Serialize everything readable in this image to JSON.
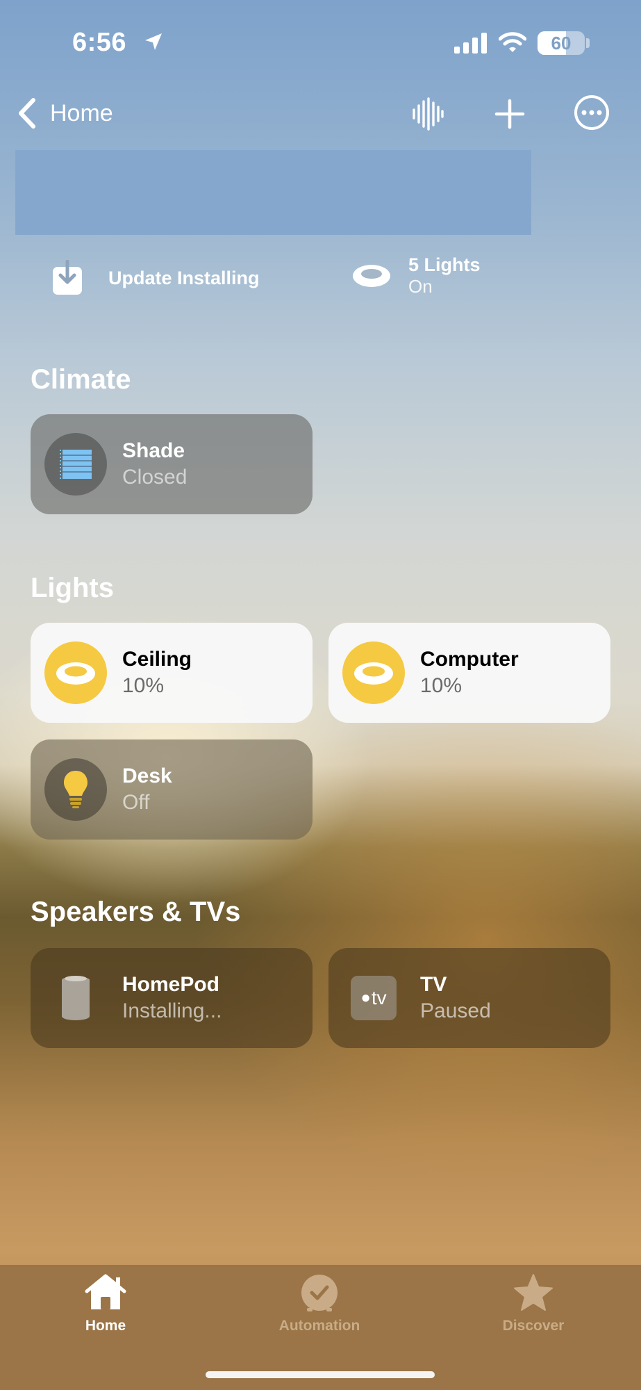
{
  "status_bar": {
    "time": "6:56",
    "battery_level": "60",
    "battery_fraction": 0.6
  },
  "nav": {
    "back_label": "Home"
  },
  "summary": {
    "update": {
      "title": "Update Installing"
    },
    "lights": {
      "title": "5 Lights",
      "subtitle": "On"
    }
  },
  "sections": {
    "climate": {
      "title": "Climate",
      "tiles": [
        {
          "name": "Shade",
          "status": "Closed",
          "icon": "window-shade-icon"
        }
      ]
    },
    "lights": {
      "title": "Lights",
      "tiles": [
        {
          "name": "Ceiling",
          "status": "10%",
          "icon": "ceiling-light-icon",
          "on": true
        },
        {
          "name": "Computer",
          "status": "10%",
          "icon": "ceiling-light-icon",
          "on": true
        },
        {
          "name": "Desk",
          "status": "Off",
          "icon": "light-bulb-icon",
          "on": false
        }
      ]
    },
    "speakers": {
      "title": "Speakers & TVs",
      "tiles": [
        {
          "name": "HomePod",
          "status": "Installing...",
          "icon": "homepod-icon"
        },
        {
          "name": "TV",
          "status": "Paused",
          "icon": "apple-tv-icon",
          "icon_text": "tv"
        }
      ]
    }
  },
  "tabbar": {
    "tabs": [
      {
        "label": "Home",
        "icon": "house-icon",
        "active": true
      },
      {
        "label": "Automation",
        "icon": "clock-check-icon",
        "active": false
      },
      {
        "label": "Discover",
        "icon": "star-icon",
        "active": false
      }
    ]
  },
  "colors": {
    "light_on": "#f5c941",
    "tile_light_bg": "#f8f8f8",
    "tabbar_bg": "#9b7547",
    "shade_blue": "#7ec3f2"
  }
}
